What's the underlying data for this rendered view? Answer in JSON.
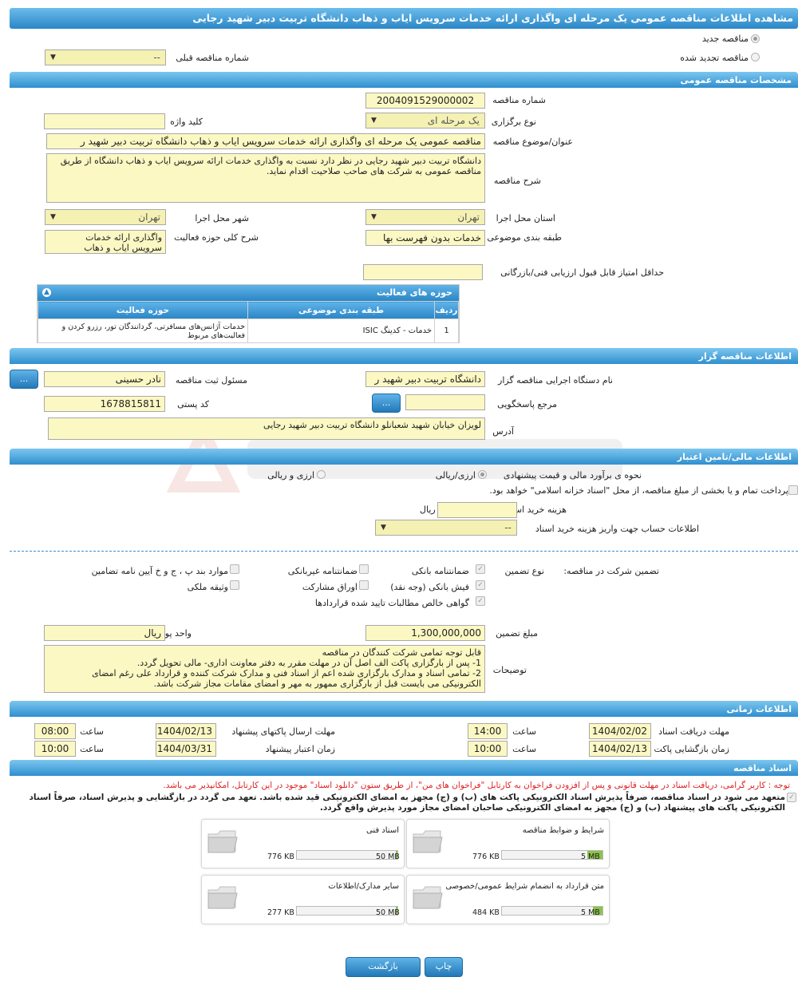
{
  "title": "مشاهده اطلاعات مناقصه عمومی یک مرحله ای واگذاری ارائه خدمات سرویس ایاب و ذهاب دانشگاه تربیت دبیر شهید رجایی",
  "top": {
    "radio_new": "مناقصه جدید",
    "radio_renewed": "مناقصه تجدید شده",
    "prev_no_label": "شماره مناقصه قبلی",
    "prev_no_value": "--"
  },
  "general": {
    "header": "مشخصات مناقصه عمومی",
    "tender_no_label": "شماره مناقصه",
    "tender_no": "2004091529000002",
    "holding_type_label": "نوع برگزاری",
    "holding_type": "یک مرحله ای",
    "keyword_label": "کلید واژه",
    "keyword": "",
    "subject_label": "عنوان/موضوع مناقصه",
    "subject": "مناقصه عمومی یک مرحله ای واگذاری ارائه خدمات سرویس ایاب و ذهاب دانشگاه تربیت دبیر شهید ر",
    "desc_label": "شرح مناقصه",
    "desc": "دانشگاه تربیت دبیر شهید رجایی در نظر دارد نسبت به واگذاری خدمات ارائه سرویس ایاب و ذهاب دانشگاه  از طریق مناقصه عمومی به شرکت های صاحب صلاحیت اقدام نماید.",
    "province_label": "استان محل اجرا",
    "province": "تهران",
    "city_label": "شهر محل اجرا",
    "city": "تهران",
    "category_label": "طبقه بندی موضوعی",
    "category": "خدمات بدون فهرست بها",
    "activity_desc_label": "شرح کلی حوزه فعالیت",
    "activity_desc": "واگذاری ارائه خدمات سرویس ایاب و ذهاب",
    "min_score_label": "حداقل امتیاز قابل قبول ارزیابی فنی/بازرگانی",
    "min_score": ""
  },
  "activities": {
    "header": "حوزه های فعالیت",
    "columns": [
      "ردیف",
      "طبقه بندی موضوعی",
      "حوزه فعالیت"
    ],
    "rows": [
      {
        "idx": "1",
        "category": "خدمات - کدینگ ISIC",
        "field": "خدمات آژانس‌های مسافرتی، گردانندگان تور، رزرو کردن و فعالیت‌های مربوط"
      }
    ]
  },
  "organizer": {
    "header": "اطلاعات مناقصه گزار",
    "org_label": "نام دستگاه اجرایی مناقصه گزار",
    "org": "دانشگاه تربیت دبیر شهید ر",
    "registrar_label": "مسئول ثبت مناقصه",
    "registrar": "نادر  حسینی",
    "ref_label": "مرجع پاسخگویی",
    "ref": "",
    "postal_label": "کد پستی",
    "postal": "1678815811",
    "address_label": "آدرس",
    "address": "لویزان خیابان شهید شعبانلو دانشگاه تربیت دبیر شهید رجایی",
    "dots": "..."
  },
  "finance": {
    "header": "اطلاعات مالی/تامین اعتبار",
    "estimate_label": "نحوه ی برآورد مالی و قیمت پیشنهادی",
    "opt_rial": "ارزی/ریالی",
    "opt_fx": "ارزی و ریالی",
    "treasury_text": "پرداخت تمام و یا بخشی از مبلغ مناقصه، از محل \"اسناد خزانه اسلامی\" خواهد بود.",
    "doc_cost_label": "هزینه خرید اسناد",
    "doc_cost": "",
    "rial": "ریال",
    "account_label": "اطلاعات حساب جهت واریز هزینه خرید اسناد",
    "account": "--"
  },
  "guarantee": {
    "label": "تضمین شرکت در مناقصه:",
    "type_label": "نوع تضمین",
    "bank_guarantee": "ضمانتنامه بانکی",
    "nonbank_guarantee": "ضمانتنامه غیربانکی",
    "items_bpjk": "موارد بند پ ، ج و خ آیین نامه تضامین",
    "cash": "فیش بانکی (وجه نقد)",
    "bonds": "اوراق مشارکت",
    "property": "وثیقه ملکی",
    "claims": "گواهی خالص مطالبات تایید شده قراردادها",
    "amount_label": "مبلغ تضمین",
    "amount": "1,300,000,000",
    "currency_label": "واحد پول",
    "currency": "ریال",
    "notes_label": "توضیحات",
    "notes": "قابل توجه تمامی شرکت کنندگان در مناقصه\n1- پس از بارگزاری پاکت الف اصل آن در مهلت مقرر به دفتر معاونت اداری- مالی تحویل گردد.\n2- تمامی اسناد و مدارک بارگزاری شده اعم از اسناد فنی و مدارک شرکت کننده و قرارداد علی رغم امضای الکترونیکی می بایست قبل از بارگزاری ممهور به مهر و امضای مقامات مجاز شرکت باشد."
  },
  "timing": {
    "header": "اطلاعات زمانی",
    "receive_deadline_label": "مهلت دریافت اسناد",
    "receive_date": "1404/02/02",
    "receive_time": "14:00",
    "send_deadline_label": "مهلت ارسال پاکتهای پیشنهاد",
    "send_date": "1404/02/13",
    "send_time": "08:00",
    "open_label": "زمان بازگشایی پاکت ها",
    "open_date": "1404/02/13",
    "open_time": "10:00",
    "validity_label": "زمان اعتبار پیشنهاد",
    "validity_date": "1404/03/31",
    "validity_time": "10:00",
    "time_label": "ساعت"
  },
  "documents": {
    "header": "اسناد مناقصه",
    "notice": "توجه : کاربر گرامی، دریافت اسناد در مهلت قانونی و پس از افزودن فراخوان به کارتابل \"فراخوان های من\"، از طریق ستون \"دانلود اسناد\" موجود در این کارتابل، امکانپذیر می باشد.",
    "commitment": "متعهد می شود در اسناد مناقصه، صرفاً پذیرش اسناد الکترونیکی پاکت های (ب) و (ج) مجهز به امضای الکترونیکی قید شده باشد. تعهد می گردد در بازگشایی و پذیرش اسناد، صرفاً اسناد الکترونیکی پاکت های پیشنهاد (ب) و (ج) مجهز به امضای الکترونیکی صاحبان امضای مجاز مورد پذیرش واقع گردد.",
    "files": [
      {
        "name": "شرایط و ضوابط مناقصه",
        "size": "776 KB",
        "max": "5 MB",
        "fill": 0.15
      },
      {
        "name": "اسناد فنی",
        "size": "776 KB",
        "max": "50 MB",
        "fill": 0.015
      },
      {
        "name": "متن قرارداد به انضمام شرایط عمومی/خصوصی",
        "size": "484 KB",
        "max": "5 MB",
        "fill": 0.095
      },
      {
        "name": "سایر مدارک/اطلاعات",
        "size": "277 KB",
        "max": "50 MB",
        "fill": 0.006
      }
    ]
  },
  "footer": {
    "print": "چاپ",
    "back": "بازگشت"
  },
  "colors": {
    "header_blue": "#2f8fcf",
    "input_yellow": "#fbf8c3",
    "progress_green": "#8bc34a",
    "notice_red": "#e02020"
  }
}
